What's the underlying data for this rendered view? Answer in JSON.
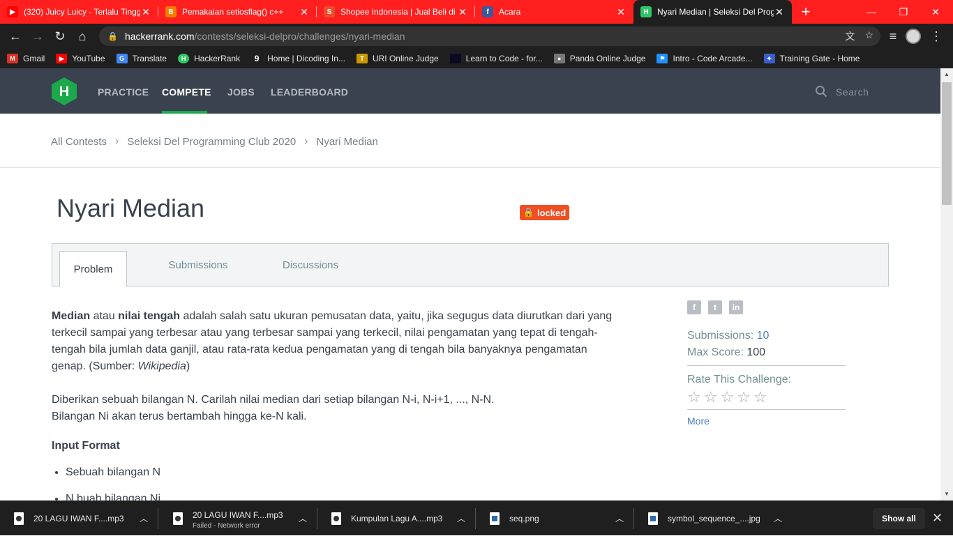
{
  "browser": {
    "tabs": [
      {
        "title": "(320) Juicy Luicy - Terlalu Tinggi",
        "favicon": "youtube-icon",
        "color": "#ff0000",
        "glyph": "▶"
      },
      {
        "title": "Pemakaian setiosflag() c++",
        "favicon": "blogger-icon",
        "color": "#f57d00",
        "glyph": "B"
      },
      {
        "title": "Shopee Indonesia | Jual Beli di",
        "favicon": "shopee-icon",
        "color": "#ee4d2d",
        "glyph": "S"
      },
      {
        "title": "Acara",
        "favicon": "facebook-icon",
        "color": "#3b5998",
        "glyph": "f"
      },
      {
        "title": "Nyari Median | Seleksi Del Prog",
        "favicon": "hackerrank-icon",
        "color": "#2ec866",
        "glyph": "H"
      }
    ],
    "active_tab": 4,
    "url_host": "hackerrank.com",
    "url_path": "/contests/seleksi-delpro/challenges/nyari-median",
    "bookmarks": [
      {
        "label": "Gmail",
        "icon": "gmail-icon",
        "color": "#d93025",
        "glyph": "M"
      },
      {
        "label": "YouTube",
        "icon": "youtube-icon",
        "color": "#ff0000",
        "glyph": "▶"
      },
      {
        "label": "Translate",
        "icon": "translate-icon",
        "color": "#4285f4",
        "glyph": "G"
      },
      {
        "label": "HackerRank",
        "icon": "hackerrank-icon",
        "color": "#2ec866",
        "glyph": "H"
      },
      {
        "label": "Home | Dicoding In...",
        "icon": "dicoding-icon",
        "color": "#1f1f1f",
        "glyph": "9"
      },
      {
        "label": "URI Online Judge",
        "icon": "trophy-icon",
        "color": "#c99a00",
        "glyph": "🏆"
      },
      {
        "label": "Learn to Code - for...",
        "icon": "freecodecamp-icon",
        "color": "#0a0a23",
        "glyph": ""
      },
      {
        "label": "Panda Online Judge",
        "icon": "panda-icon",
        "color": "#777777",
        "glyph": "●"
      },
      {
        "label": "Intro - Code Arcade...",
        "icon": "codesignal-icon",
        "color": "#1e90ff",
        "glyph": "⚑"
      },
      {
        "label": "Training Gate - Home",
        "icon": "training-gate-icon",
        "color": "#3a5fcd",
        "glyph": "✦"
      }
    ]
  },
  "site": {
    "nav": [
      "PRACTICE",
      "COMPETE",
      "JOBS",
      "LEADERBOARD"
    ],
    "active_nav": "COMPETE",
    "search_placeholder": "Search",
    "brand_color": "#1ba94c"
  },
  "breadcrumb": [
    "All Contests",
    "Seleksi Del Programming Club 2020",
    "Nyari Median"
  ],
  "challenge": {
    "title": "Nyari Median",
    "badge": "locked",
    "tabs": [
      "Problem",
      "Submissions",
      "Discussions"
    ],
    "active_tab": "Problem",
    "p1_b1": "Median",
    "p1_t1": " atau ",
    "p1_b2": "nilai tengah",
    "p1_t2": " adalah salah satu ukuran pemusatan data, yaitu, jika segugus data diurutkan dari yang terkecil sampai yang terbesar atau yang terbesar sampai yang terkecil, nilai pengamatan yang tepat di tengah-tengah bila jumlah data ganjil, atau rata-rata kedua pengamatan yang di tengah bila banyaknya pengamatan genap. (Sumber: ",
    "p1_i": "Wikipedia",
    "p1_t3": ")",
    "p2_line1": "Diberikan sebuah bilangan N. Carilah nilai median dari setiap bilangan N-i, N-i+1, ..., N-N.",
    "p2_line2": "Bilangan Ni akan terus bertambah hingga ke-N kali.",
    "input_heading": "Input Format",
    "input_items": [
      "Sebuah bilangan N",
      "N buah bilangan Ni"
    ]
  },
  "sidebar": {
    "share": [
      "facebook-icon",
      "twitter-icon",
      "linkedin-icon"
    ],
    "submissions_label": "Submissions:",
    "submissions_value": "10",
    "max_score_label": "Max Score:",
    "max_score_value": "100",
    "rate_label": "Rate This Challenge:",
    "rating": 0,
    "more": "More"
  },
  "downloads": [
    {
      "name": "20 LAGU IWAN F....mp3",
      "status": "",
      "type": "audio"
    },
    {
      "name": "20 LAGU IWAN F....mp3",
      "status": "Failed - Network error",
      "type": "audio"
    },
    {
      "name": "Kumpulan Lagu A....mp3",
      "status": "",
      "type": "audio"
    },
    {
      "name": "seq.png",
      "status": "",
      "type": "image"
    },
    {
      "name": "symbol_sequence_....jpg",
      "status": "",
      "type": "image"
    }
  ],
  "show_all": "Show all"
}
